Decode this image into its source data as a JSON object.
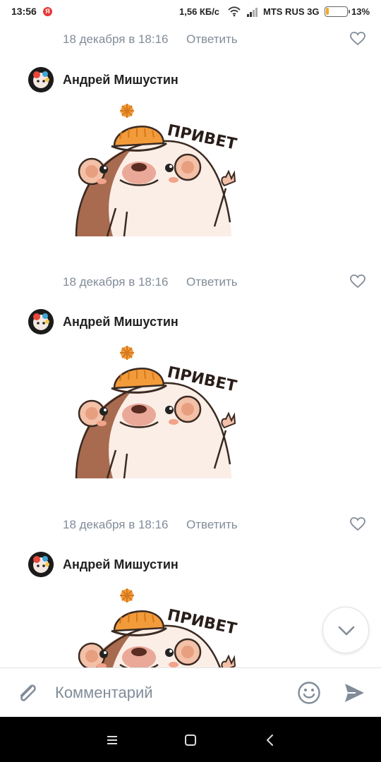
{
  "status_bar": {
    "time": "13:56",
    "yandex_badge": "Я",
    "speed": "1,56 КБ/с",
    "carrier": "MTS RUS 3G",
    "battery_percent": "13%",
    "battery_level": 0.13,
    "battery_color": "#f5a623",
    "wifi_icon": "wifi-icon",
    "signal_icon": "signal-icon"
  },
  "feed": {
    "meta_rows": [
      {
        "date": "18 декабря в 18:16",
        "reply": "Ответить",
        "like_icon": "heart-outline-icon"
      },
      {
        "date": "18 декабря в 18:16",
        "reply": "Ответить",
        "like_icon": "heart-outline-icon"
      },
      {
        "date": "18 декабря в 18:16",
        "reply": "Ответить",
        "like_icon": "heart-outline-icon"
      }
    ],
    "comments": [
      {
        "author": "Андрей Мишустин",
        "sticker_text": "ПРИВЕТ",
        "sticker_name": "hedgehog-hello-sticker"
      },
      {
        "author": "Андрей Мишустин",
        "sticker_text": "ПРИВЕТ",
        "sticker_name": "hedgehog-hello-sticker"
      },
      {
        "author": "Андрей Мишустин",
        "sticker_text": "ПРИВЕТ",
        "sticker_name": "hedgehog-hello-sticker"
      }
    ]
  },
  "scroll_button": {
    "icon": "chevron-down-icon"
  },
  "comment_bar": {
    "placeholder": "Комментарий",
    "attach_icon": "paperclip-icon",
    "emoji_icon": "smiley-icon",
    "send_icon": "send-icon",
    "accent_color": "#818c99"
  },
  "nav_bar": {
    "menu_icon": "menu-icon",
    "home_icon": "home-square-icon",
    "back_icon": "back-chevron-icon"
  }
}
